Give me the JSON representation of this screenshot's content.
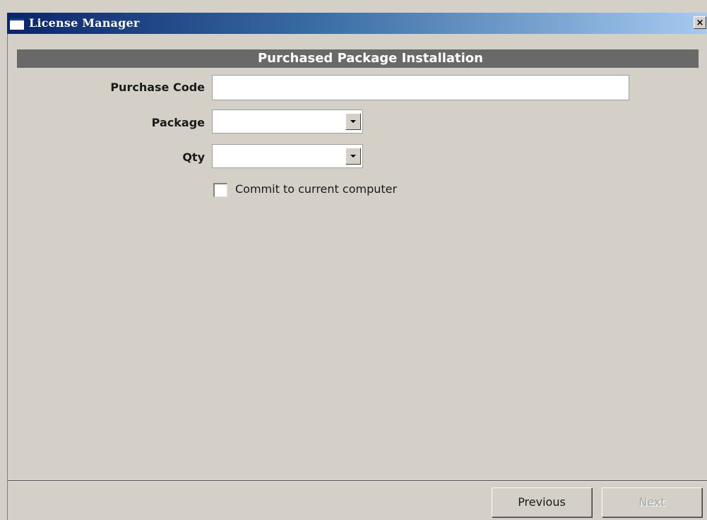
{
  "window": {
    "title": "License Manager",
    "close_glyph": "×"
  },
  "header": {
    "title": "Purchased Package Installation"
  },
  "form": {
    "purchase_code": {
      "label": "Purchase Code",
      "value": ""
    },
    "package": {
      "label": "Package",
      "selected": ""
    },
    "qty": {
      "label": "Qty",
      "selected": ""
    },
    "commit": {
      "label": "Commit to current computer",
      "checked": false
    }
  },
  "footer": {
    "previous_label": "Previous",
    "next_label": "Next",
    "next_enabled": false
  },
  "icons": [
    "window-icon",
    "close-icon",
    "chevron-down-icon"
  ],
  "colors": {
    "titlebar_start": "#0a246a",
    "titlebar_end": "#a6caf0",
    "header_bg": "#696969",
    "window_bg": "#d4d0c8"
  }
}
